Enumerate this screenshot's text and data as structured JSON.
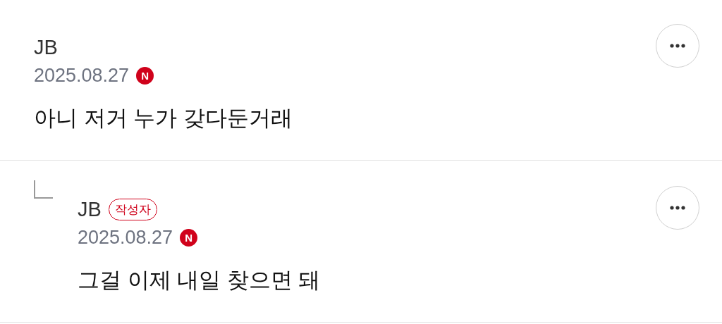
{
  "comments": [
    {
      "kind": "comment",
      "author": "JB",
      "date": "2025.08.27",
      "new_badge": "N",
      "text": "아니 저거 누가 갖다둔거래"
    },
    {
      "kind": "reply",
      "author": "JB",
      "author_badge": "작성자",
      "date": "2025.08.27",
      "new_badge": "N",
      "text": "그걸 이제 내일 찾으면 돼"
    }
  ]
}
